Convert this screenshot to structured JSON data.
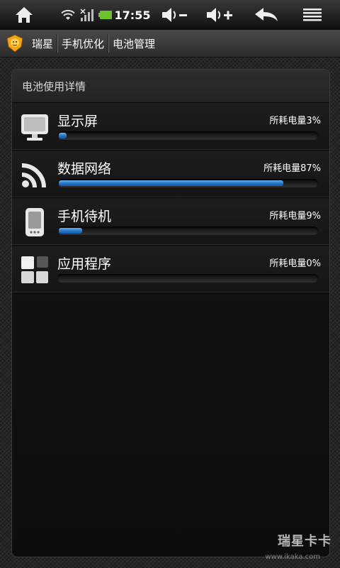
{
  "status_bar": {
    "time": "17:55",
    "icons": [
      "home-icon",
      "wifi-icon",
      "signal-icon",
      "battery-icon",
      "volume-down-icon",
      "volume-up-icon",
      "back-icon",
      "menu-icon"
    ]
  },
  "breadcrumb": {
    "items": [
      {
        "label": "瑞星"
      },
      {
        "label": "手机优化"
      },
      {
        "label": "电池管理"
      }
    ]
  },
  "panel": {
    "title": "电池使用详情",
    "rows": [
      {
        "name": "显示屏",
        "usage": "所耗电量3%",
        "percent": 3,
        "icon": "monitor-icon"
      },
      {
        "name": "数据网络",
        "usage": "所耗电量87%",
        "percent": 87,
        "icon": "network-icon"
      },
      {
        "name": "手机待机",
        "usage": "所耗电量9%",
        "percent": 9,
        "icon": "phone-icon"
      },
      {
        "name": "应用程序",
        "usage": "所耗电量0%",
        "percent": 0,
        "icon": "apps-icon"
      }
    ]
  },
  "watermark": {
    "brand": "瑞星卡卡",
    "url": "www.ikaka.com"
  },
  "colors": {
    "bar_fill": "#2a7fd4",
    "panel_bg": "#141414"
  }
}
